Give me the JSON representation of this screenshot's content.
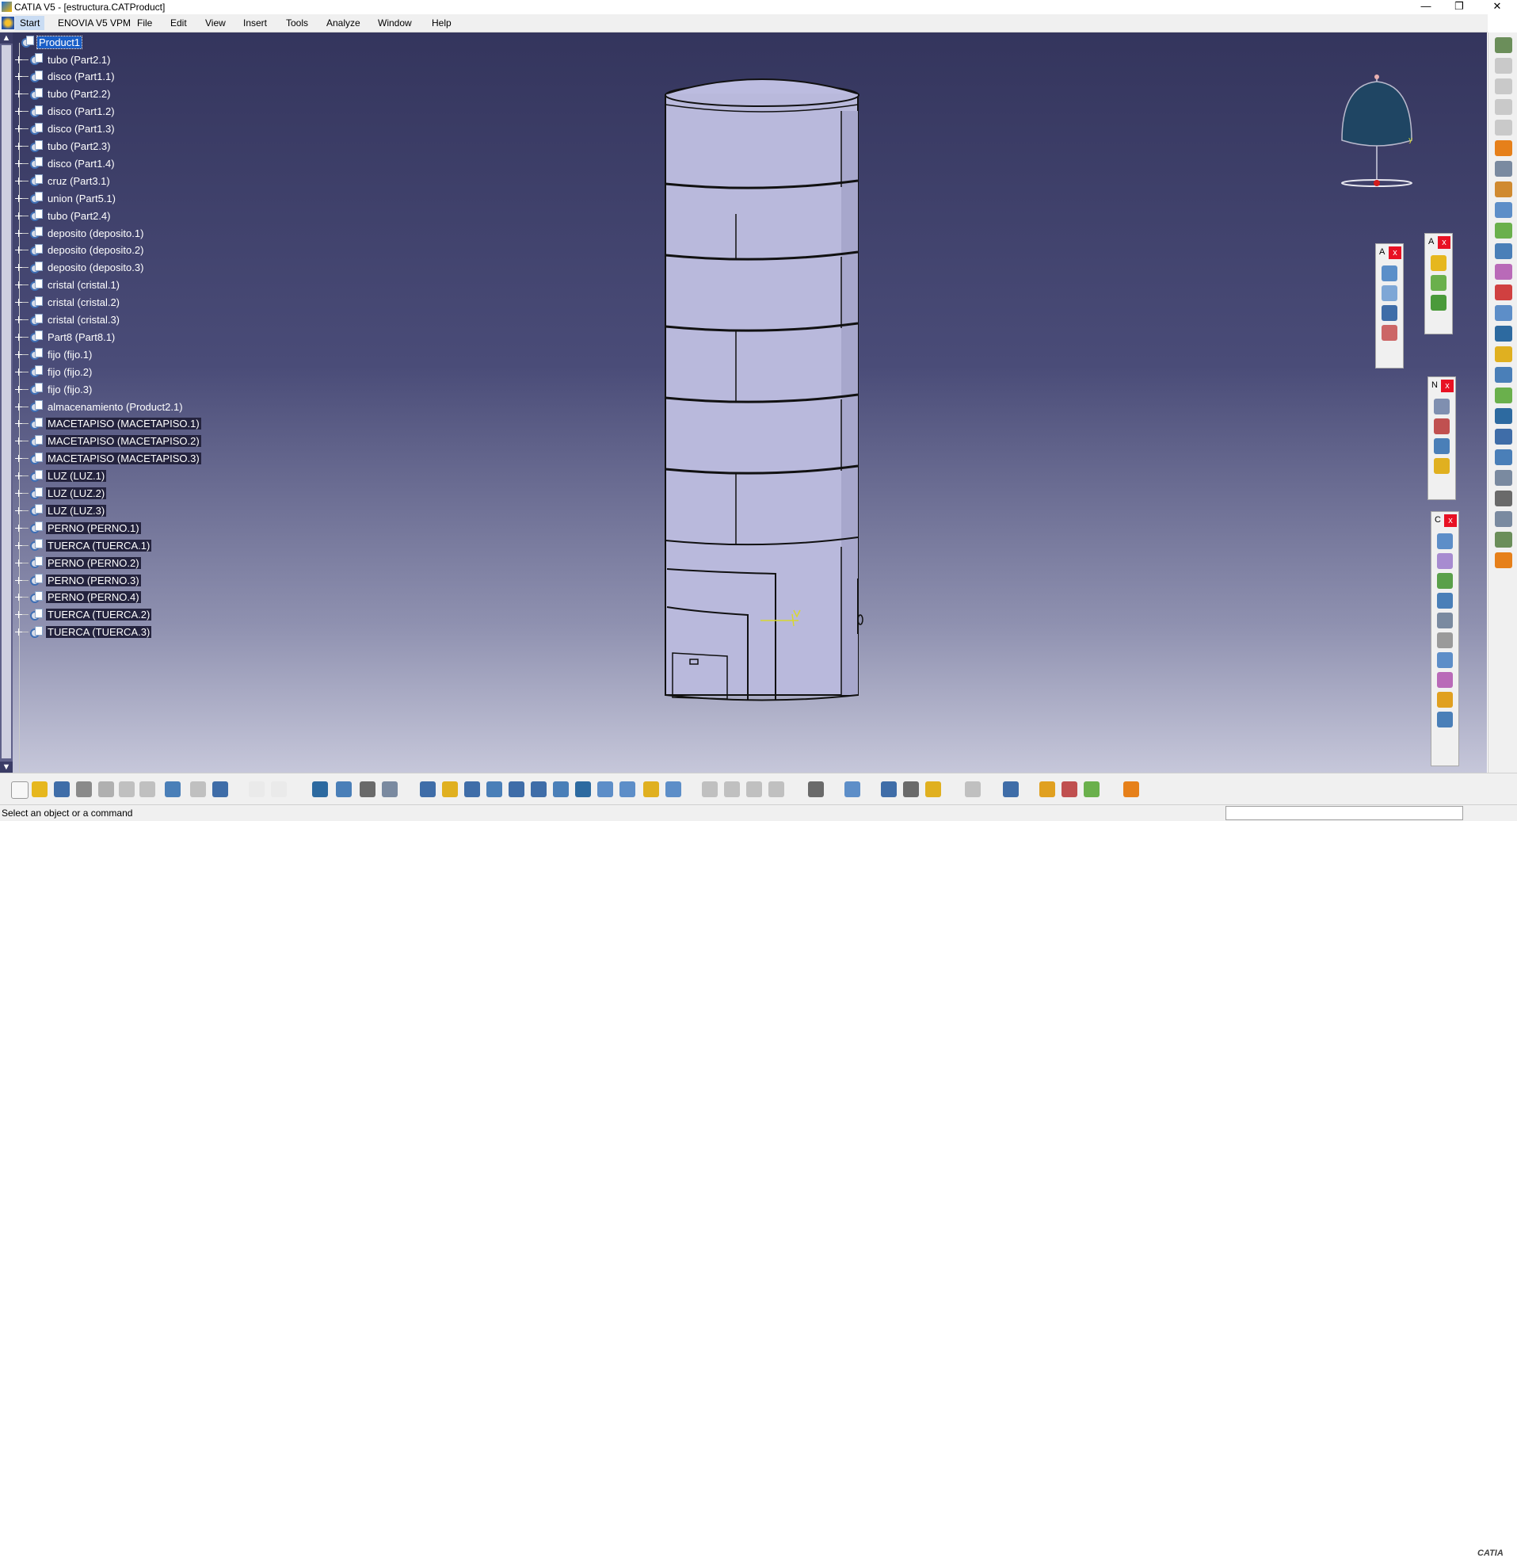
{
  "window": {
    "title": "CATIA V5 - [estructura.CATProduct]",
    "minimize": "—",
    "maximize": "❐",
    "close": "✕"
  },
  "menu": [
    "Start",
    "ENOVIA V5 VPM",
    "File",
    "Edit",
    "View",
    "Insert",
    "Tools",
    "Analyze",
    "Window",
    "Help"
  ],
  "tree": {
    "root": "Product1",
    "items": [
      "tubo (Part2.1)",
      "disco (Part1.1)",
      "tubo (Part2.2)",
      "disco (Part1.2)",
      "disco (Part1.3)",
      "tubo (Part2.3)",
      "disco (Part1.4)",
      "cruz (Part3.1)",
      "union (Part5.1)",
      "tubo (Part2.4)",
      "deposito (deposito.1)",
      "deposito (deposito.2)",
      "deposito (deposito.3)",
      "cristal (cristal.1)",
      "cristal (cristal.2)",
      "cristal (cristal.3)",
      "Part8 (Part8.1)",
      "fijo (fijo.1)",
      "fijo (fijo.2)",
      "fijo (fijo.3)",
      "almacenamiento (Product2.1)",
      "MACETAPISO (MACETAPISO.1)",
      "MACETAPISO (MACETAPISO.2)",
      "MACETAPISO (MACETAPISO.3)",
      "LUZ (LUZ.1)",
      "LUZ (LUZ.2)",
      "LUZ (LUZ.3)",
      "PERNO (PERNO.1)",
      "TUERCA (TUERCA.1)",
      "PERNO (PERNO.2)",
      "PERNO (PERNO.3)",
      "PERNO (PERNO.4)",
      "TUERCA (TUERCA.2)",
      "TUERCA (TUERCA.3)"
    ]
  },
  "floating_toolbars": [
    "A",
    "A",
    "N",
    "C"
  ],
  "status": {
    "message": "Select an object or a command"
  },
  "logo": "CATIA",
  "colors": {
    "viewport_top": "#34355d",
    "viewport_bottom": "#c6c7da",
    "part_fill": "#b9b9dc",
    "selection": "#1a5fc7"
  }
}
